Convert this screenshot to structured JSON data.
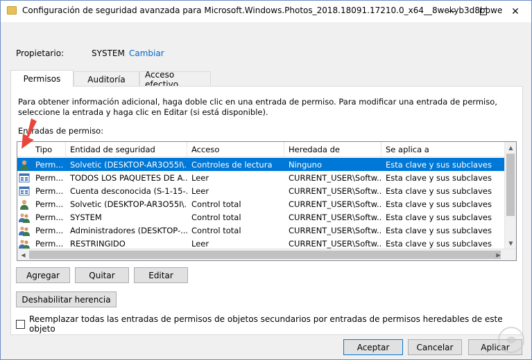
{
  "window": {
    "title": "Configuración de seguridad avanzada para Microsoft.Windows.Photos_2018.18091.17210.0_x64__8wekyb3d8bbwe",
    "minimize_icon": "minimize-icon",
    "maximize_icon": "maximize-icon",
    "close_icon": "close-icon",
    "close_glyph": "✕"
  },
  "owner": {
    "label": "Propietario:",
    "value": "SYSTEM",
    "change_link": "Cambiar"
  },
  "tabs": [
    {
      "label": "Permisos",
      "active": true
    },
    {
      "label": "Auditoría",
      "active": false
    },
    {
      "label": "Acceso efectivo",
      "active": false
    }
  ],
  "info_text": "Para obtener información adicional, haga doble clic en una entrada de permiso. Para modificar una entrada de permiso, seleccione la entrada y haga clic en Editar (si está disponible).",
  "entries_label": "Entradas de permiso:",
  "table": {
    "columns": [
      "Tipo",
      "Entidad de seguridad",
      "Acceso",
      "Heredada de",
      "Se aplica a"
    ],
    "rows": [
      {
        "icon": "user-icon",
        "type": "Perm...",
        "entity": "Solvetic (DESKTOP-AR3O55I\\...",
        "access": "Controles de lectura",
        "inherited": "Ninguno",
        "applies": "Esta clave y sus subclaves",
        "selected": true
      },
      {
        "icon": "app-package-icon",
        "type": "Perm...",
        "entity": "TODOS LOS PAQUETES DE A...",
        "access": "Leer",
        "inherited": "CURRENT_USER\\Softw...",
        "applies": "Esta clave y sus subclaves",
        "selected": false
      },
      {
        "icon": "app-package-icon",
        "type": "Perm...",
        "entity": "Cuenta desconocida (S-1-15-...",
        "access": "Leer",
        "inherited": "CURRENT_USER\\Softw...",
        "applies": "Esta clave y sus subclaves",
        "selected": false
      },
      {
        "icon": "user-icon",
        "type": "Perm...",
        "entity": "Solvetic (DESKTOP-AR3O55I\\...",
        "access": "Control total",
        "inherited": "CURRENT_USER\\Softw...",
        "applies": "Esta clave y sus subclaves",
        "selected": false
      },
      {
        "icon": "group-icon",
        "type": "Perm...",
        "entity": "SYSTEM",
        "access": "Control total",
        "inherited": "CURRENT_USER\\Softw...",
        "applies": "Esta clave y sus subclaves",
        "selected": false
      },
      {
        "icon": "group-icon",
        "type": "Perm...",
        "entity": "Administradores (DESKTOP-...",
        "access": "Control total",
        "inherited": "CURRENT_USER\\Softw...",
        "applies": "Esta clave y sus subclaves",
        "selected": false
      },
      {
        "icon": "group-icon",
        "type": "Perm...",
        "entity": "RESTRINGIDO",
        "access": "Leer",
        "inherited": "CURRENT_USER\\Softw...",
        "applies": "Esta clave y sus subclaves",
        "selected": false
      }
    ]
  },
  "buttons": {
    "add": "Agregar",
    "remove": "Quitar",
    "edit": "Editar",
    "disable_inheritance": "Deshabilitar herencia",
    "ok": "Aceptar",
    "cancel": "Cancelar",
    "apply": "Aplicar"
  },
  "replace_checkbox_label": "Reemplazar todas las entradas de permisos de objetos secundarios por entradas de permisos heredables de este objeto",
  "colors": {
    "selection": "#0078d7",
    "link": "#0066cc",
    "annotation_arrow": "#e8463c"
  }
}
